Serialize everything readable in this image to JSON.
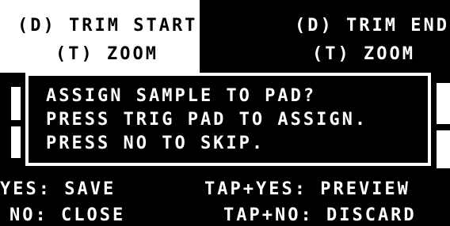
{
  "header": {
    "trim_start": {
      "line1": "(D) TRIM START",
      "line2": "(T) ZOOM"
    },
    "trim_end": {
      "line1": "(D) TRIM END",
      "line2": "(T) ZOOM"
    }
  },
  "dialog": {
    "line1": "ASSIGN SAMPLE TO PAD?",
    "line2": "PRESS TRIG PAD TO ASSIGN.",
    "line3": "PRESS NO TO SKIP."
  },
  "footer": {
    "yes_save": "YES: SAVE",
    "no_close": "NO: CLOSE",
    "tap_yes_preview": "TAP+YES: PREVIEW",
    "tap_no_discard": "TAP+NO: DISCARD"
  }
}
